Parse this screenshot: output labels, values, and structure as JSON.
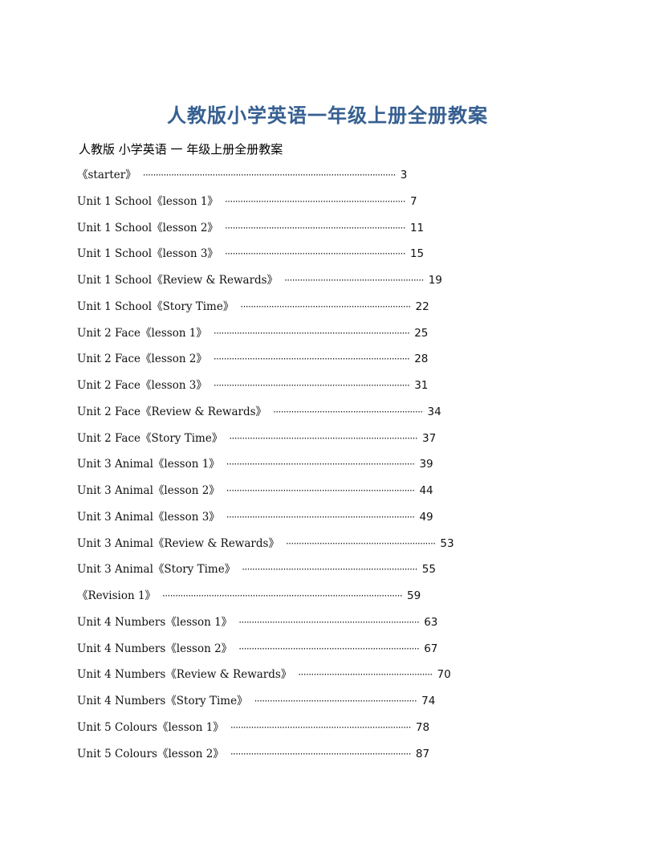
{
  "document": {
    "title": "人教版小学英语一年级上册全册教案",
    "subtitle": "人教版 小学英语 一 年级上册全册教案",
    "colors": {
      "title": "#365f91",
      "text": "#111111"
    },
    "toc": [
      {
        "label": "《starter》",
        "page": "3",
        "dot_end": 493
      },
      {
        "label": "Unit 1 School《lesson 1》",
        "page": "7",
        "dot_end": 505
      },
      {
        "label": "Unit 1 School《lesson 2》",
        "page": "11",
        "dot_end": 505
      },
      {
        "label": "Unit 1 School《lesson 3》",
        "page": "15",
        "dot_end": 505
      },
      {
        "label": "Unit 1 School《Review & Rewards》",
        "page": "19",
        "dot_end": 528
      },
      {
        "label": "Unit 1 School《Story Time》",
        "page": "22",
        "dot_end": 514
      },
      {
        "label": "Unit 2 Face《lesson 1》",
        "page": "25",
        "dot_end": 511
      },
      {
        "label": "Unit 2 Face《lesson 2》",
        "page": "28",
        "dot_end": 511
      },
      {
        "label": "Unit 2 Face《lesson 3》",
        "page": "31",
        "dot_end": 511
      },
      {
        "label": "Unit 2 Face《Review & Rewards》",
        "page": "34",
        "dot_end": 528
      },
      {
        "label": "Unit 2 Face《Story Time》",
        "page": "37",
        "dot_end": 520
      },
      {
        "label": "Unit 3 Animal《lesson 1》",
        "page": "39",
        "dot_end": 517
      },
      {
        "label": "Unit 3 Animal《lesson 2》",
        "page": "44",
        "dot_end": 517
      },
      {
        "label": "Unit 3 Animal《lesson 3》",
        "page": "49",
        "dot_end": 517
      },
      {
        "label": "Unit 3 Animal《Review & Rewards》",
        "page": "53",
        "dot_end": 543
      },
      {
        "label": "Unit 3 Animal《Story Time》",
        "page": "55",
        "dot_end": 521
      },
      {
        "label": "《Revision 1》",
        "page": "59",
        "dot_end": 501
      },
      {
        "label": "Unit 4 Numbers《lesson 1》",
        "page": "63",
        "dot_end": 523
      },
      {
        "label": "Unit 4 Numbers《lesson 2》",
        "page": "67",
        "dot_end": 523
      },
      {
        "label": "Unit 4 Numbers《Review & Rewards》",
        "page": "70",
        "dot_end": 541
      },
      {
        "label": "Unit 4 Numbers《Story Time》",
        "page": "74",
        "dot_end": 521
      },
      {
        "label": "Unit 5 Colours《lesson 1》",
        "page": "78",
        "dot_end": 512
      },
      {
        "label": "Unit 5 Colours《lesson 2》",
        "page": "87",
        "dot_end": 512
      }
    ]
  }
}
